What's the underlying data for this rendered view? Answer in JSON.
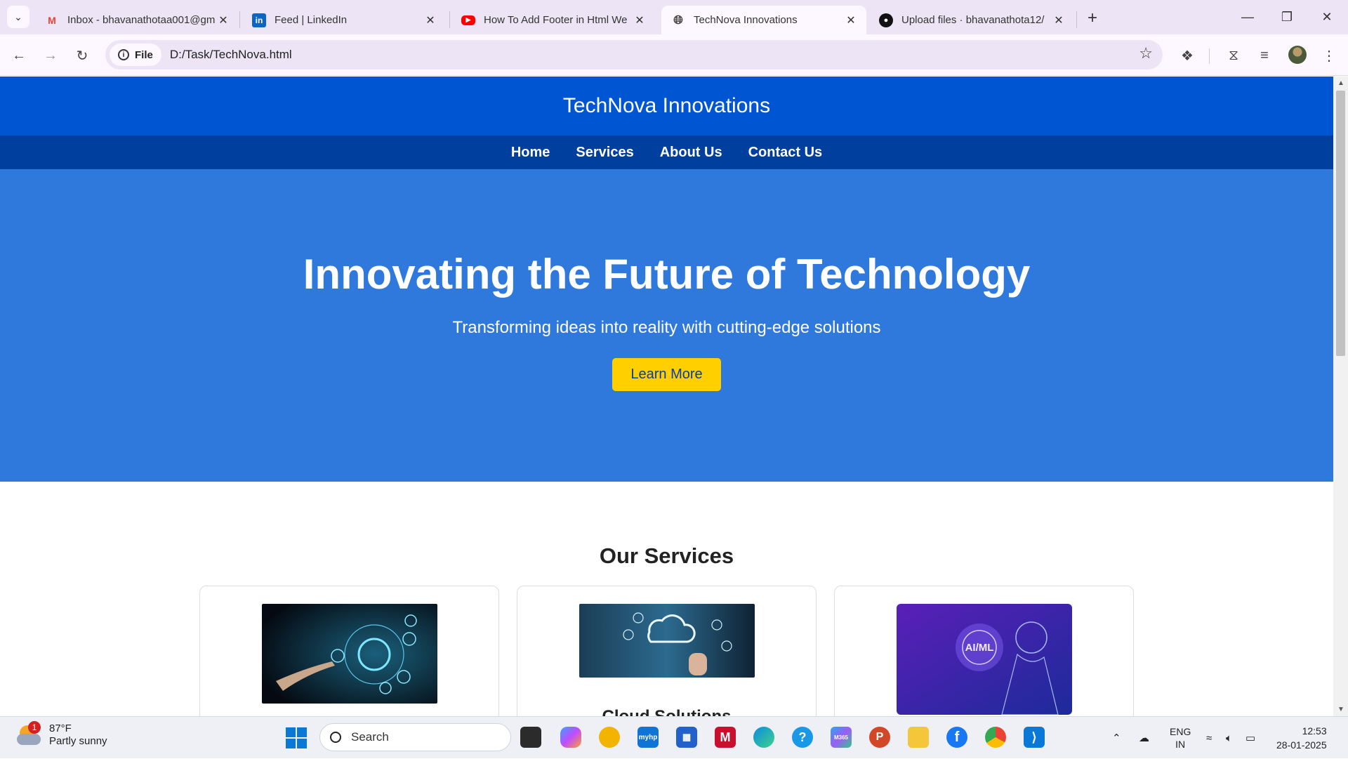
{
  "browser": {
    "tabs": [
      {
        "title": "Inbox - bhavanathotaa001@gm",
        "icon": "gmail-icon",
        "color": "#ea4335"
      },
      {
        "title": "Feed | LinkedIn",
        "icon": "linkedin-icon",
        "color": "#0a66c2"
      },
      {
        "title": "How To Add Footer in Html We",
        "icon": "youtube-icon",
        "color": "#ff0000"
      },
      {
        "title": "TechNova Innovations",
        "icon": "globe-icon",
        "color": "#444444",
        "active": true
      },
      {
        "title": "Upload files · bhavanathota12/",
        "icon": "github-icon",
        "color": "#111111"
      }
    ],
    "omnibox": {
      "chip_label": "File",
      "url": "D:/Task/TechNova.html"
    }
  },
  "site": {
    "brand": "TechNova Innovations",
    "nav": [
      "Home",
      "Services",
      "About Us",
      "Contact Us"
    ],
    "hero": {
      "title": "Innovating the Future of Technology",
      "subtitle": "Transforming ideas into reality with cutting-edge solutions",
      "cta": "Learn More"
    },
    "services": {
      "heading": "Our Services",
      "cards": [
        {
          "image": "web-development-image",
          "title": ""
        },
        {
          "image": "cloud-solutions-image",
          "title": "Cloud Solutions"
        },
        {
          "image": "ai-ml-image",
          "title": "",
          "image_label": "AI/ML"
        }
      ]
    },
    "colors": {
      "header": "#0056d2",
      "nav": "#003f9e",
      "hero": "#3079dc",
      "cta": "#ffcf00"
    }
  },
  "taskbar": {
    "weather": {
      "temp": "87°F",
      "condition": "Partly sunny",
      "badge": "1"
    },
    "search_placeholder": "Search",
    "apps": [
      "file-explorer-icon",
      "copilot-icon",
      "chrome-canary-icon",
      "myhp-icon",
      "store-icon",
      "mcafee-icon",
      "edge-icon",
      "tips-icon",
      "m365-icon",
      "powerpoint-icon",
      "files-icon",
      "facebook-icon",
      "chrome-icon",
      "vscode-icon"
    ],
    "myhp_label": "myhp",
    "m365_label": "M365",
    "language": {
      "line1": "ENG",
      "line2": "IN"
    },
    "clock": {
      "time": "12:53",
      "date": "28-01-2025"
    }
  }
}
